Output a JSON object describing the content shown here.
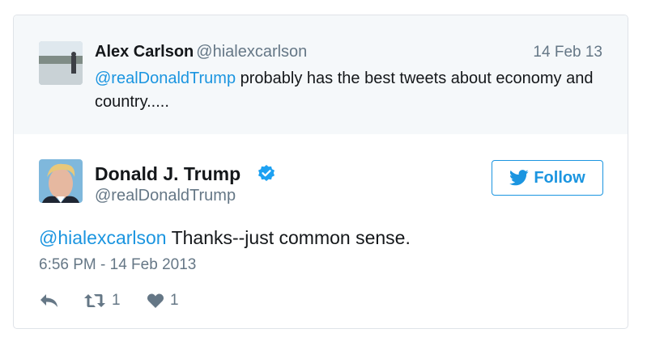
{
  "parent_tweet": {
    "name": "Alex Carlson",
    "handle": "@hialexcarlson",
    "date": "14 Feb 13",
    "mention": "@realDonaldTrump",
    "text": " probably has the best tweets about economy and country....."
  },
  "main_tweet": {
    "name": "Donald J. Trump",
    "handle": "@realDonaldTrump",
    "follow_label": "Follow",
    "mention": "@hialexcarlson",
    "text": " Thanks--just common sense.",
    "timestamp": "6:56 PM - 14 Feb 2013"
  },
  "actions": {
    "retweet_count": "1",
    "like_count": "1"
  },
  "colors": {
    "accent": "#1b95e0",
    "muted": "#657786",
    "parent_bg": "#f5f8fa"
  }
}
